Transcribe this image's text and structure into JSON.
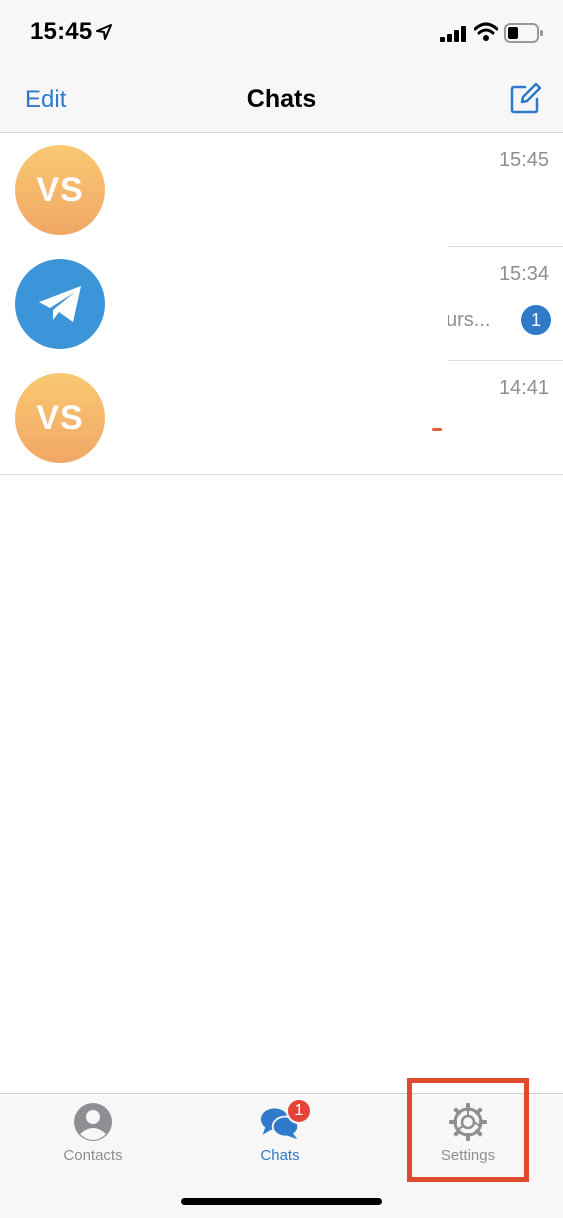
{
  "status_bar": {
    "time": "15:45"
  },
  "nav": {
    "edit_label": "Edit",
    "title": "Chats"
  },
  "chats": [
    {
      "avatar_initials": "VS",
      "avatar_color": "orange",
      "time": "15:45",
      "preview": "",
      "unread": ""
    },
    {
      "avatar_initials": "",
      "avatar_color": "blue",
      "avatar_icon": "telegram-icon",
      "time": "15:34",
      "preview": "urs...",
      "unread": "1"
    },
    {
      "avatar_initials": "VS",
      "avatar_color": "orange",
      "time": "14:41",
      "preview": "",
      "unread": ""
    }
  ],
  "tabs": {
    "contacts_label": "Contacts",
    "chats_label": "Chats",
    "chats_badge": "1",
    "settings_label": "Settings"
  },
  "colors": {
    "accent": "#2f7ac9",
    "badge_red": "#e5443a",
    "highlight": "#e04a2c",
    "avatar_orange": "#f4b46b",
    "avatar_blue": "#3d95d9"
  }
}
